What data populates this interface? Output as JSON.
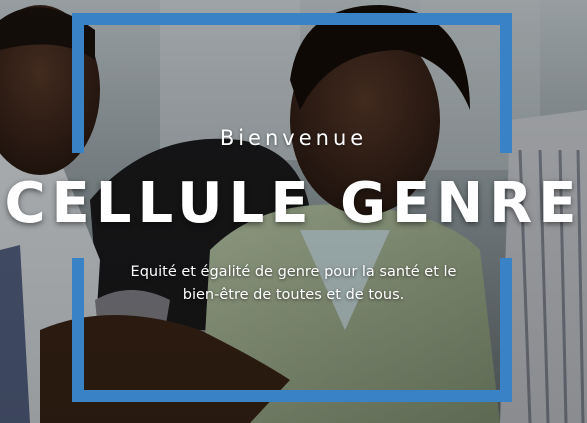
{
  "hero": {
    "welcome": "Bienvenue",
    "title": "CELLULE GENRE",
    "subtitle": "Equité et égalité de genre pour la santé et le bien-être de toutes et de tous."
  },
  "colors": {
    "frame": "#3a82c6",
    "text": "#ffffff"
  }
}
